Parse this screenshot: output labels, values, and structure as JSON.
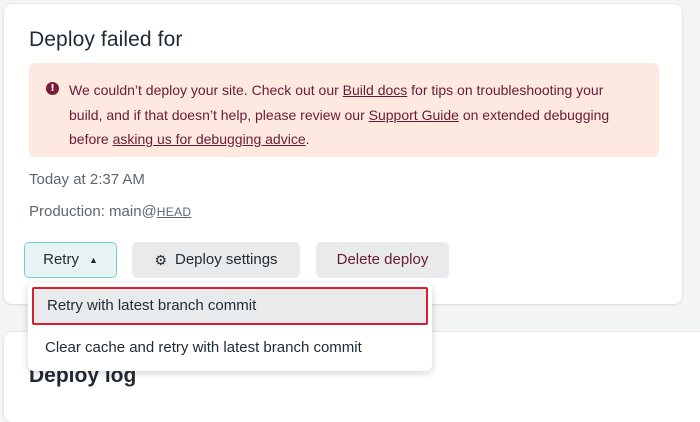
{
  "deploy": {
    "title": "Deploy failed for",
    "alert": {
      "text_1": "We couldn’t deploy your site. Check out our ",
      "link_build_docs": "Build docs",
      "text_2": " for tips on troubleshooting your build, and if that doesn’t help, please review our ",
      "link_support_guide": "Support Guide",
      "text_3": " on extended debugging before ",
      "link_debug_advice": "asking us for debugging advice",
      "text_4": ".",
      "icon": "exclamation-circle-icon"
    },
    "timestamp": "Today at 2:37 AM",
    "production_label": "Production: main@",
    "production_ref": "HEAD"
  },
  "buttons": {
    "retry": "Retry",
    "retry_caret": "▲",
    "deploy_settings": "Deploy settings",
    "delete_deploy": "Delete deploy"
  },
  "dropdown": {
    "items": [
      "Retry with latest branch commit",
      "Clear cache and retry with latest branch commit"
    ]
  },
  "deploy_log": {
    "title": "Deploy log"
  },
  "colors": {
    "alert_bg": "#fde9e0",
    "alert_text": "#6b1a35",
    "retry_border": "#6fd1cc",
    "highlight_border": "#d81f2f"
  }
}
